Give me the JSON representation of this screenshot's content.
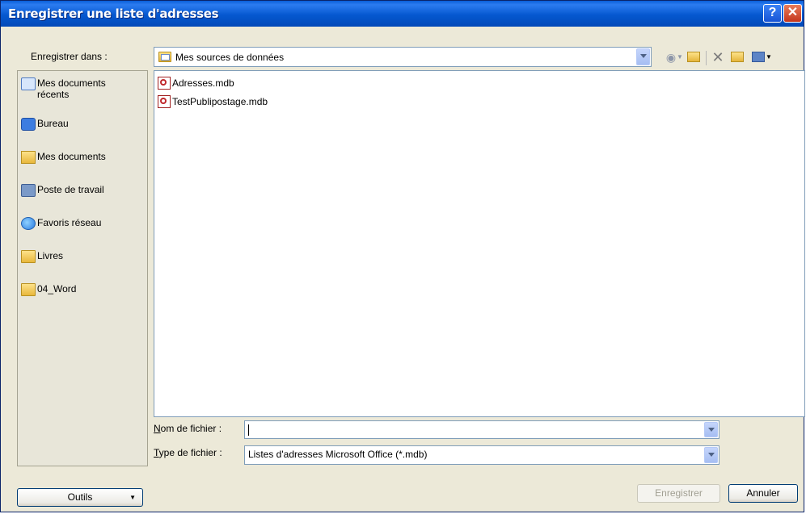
{
  "window": {
    "title": "Enregistrer une liste d'adresses",
    "help_glyph": "?",
    "close_glyph": "✕"
  },
  "save_in": {
    "label": "Enregistrer dans :",
    "value": "Mes sources de données"
  },
  "toolbar": {
    "back_glyph": "◉",
    "delete_glyph": "✕",
    "dropdown_glyph": "▼"
  },
  "places": [
    {
      "label": "Mes documents récents",
      "icon": "recent-documents-icon"
    },
    {
      "label": "Bureau",
      "icon": "desktop-icon"
    },
    {
      "label": "Mes documents",
      "icon": "my-documents-icon"
    },
    {
      "label": "Poste de travail",
      "icon": "computer-icon"
    },
    {
      "label": "Favoris réseau",
      "icon": "network-icon"
    },
    {
      "label": "Livres",
      "icon": "folder-icon"
    },
    {
      "label": "04_Word",
      "icon": "folder-icon"
    }
  ],
  "files": [
    {
      "name": "Adresses.mdb",
      "icon": "access-database-icon"
    },
    {
      "name": "TestPublipostage.mdb",
      "icon": "access-database-icon"
    }
  ],
  "filename": {
    "label_first": "N",
    "label_rest": "om de fichier :",
    "value": ""
  },
  "filetype": {
    "label_first": "T",
    "label_rest": "ype de fichier :",
    "value": "Listes d'adresses Microsoft Office (*.mdb)"
  },
  "buttons": {
    "tools_label": "Outils",
    "tools_dd": "▼",
    "save_label": "Enregistrer",
    "cancel_label": "Annuler"
  }
}
